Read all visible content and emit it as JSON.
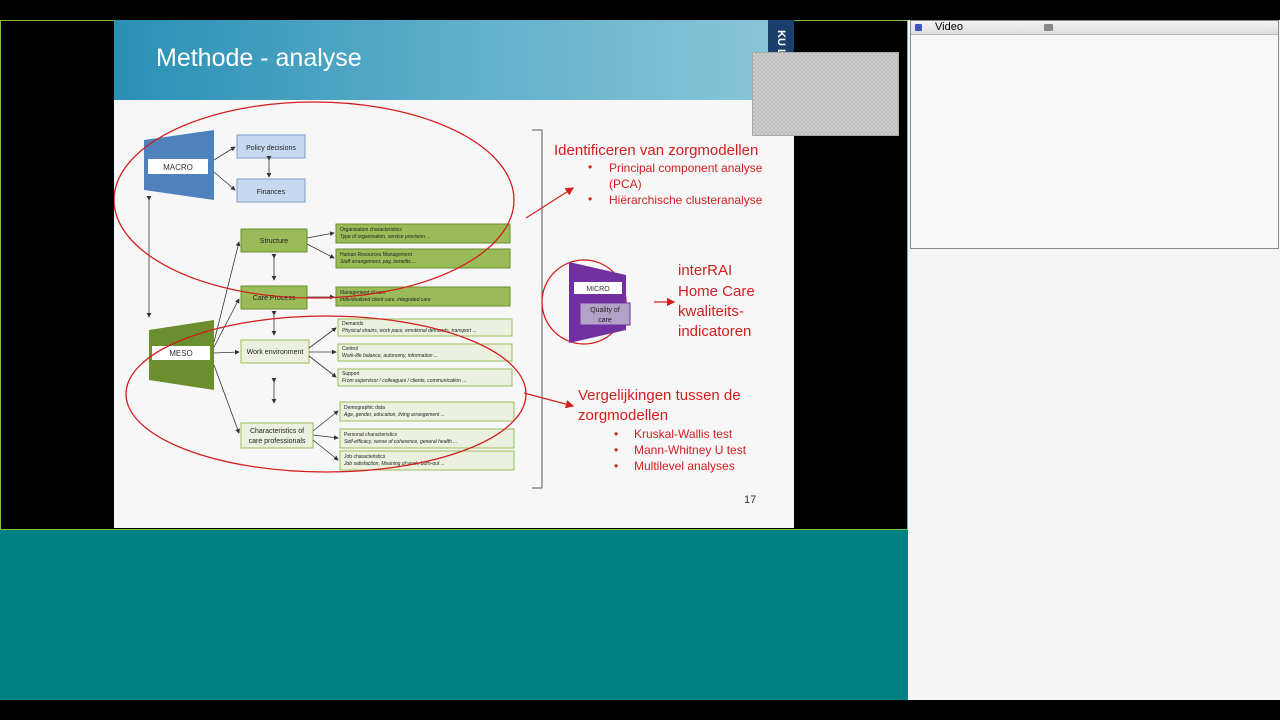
{
  "video_window": {
    "title": "Video"
  },
  "slide": {
    "title": "Methode - analyse",
    "page_number": "17",
    "logo_text": "KU L",
    "diagram": {
      "macro_label": "MACRO",
      "policy": "Policy decisions",
      "finances": "Finances",
      "meso_label": "MESO",
      "structure": "Structure",
      "care_process": "Care Process",
      "work_environment": "Work environment",
      "characteristics_line1": "Characteristics of",
      "characteristics_line2": "care professionals",
      "boxes": [
        {
          "title": "Organisation characteristics",
          "sub": "Type of organisation, service provision ..."
        },
        {
          "title": "Human Resources Management",
          "sub": "Staff arrangement, pay, benefits ..."
        },
        {
          "title": "Management of care",
          "sub": "Individualized client care, integrated care"
        },
        {
          "title": "Demands",
          "sub": "Physical strains, work pace, emotional demands, transport ..."
        },
        {
          "title": "Control",
          "sub": "Work-life balance, autonomy, information ..."
        },
        {
          "title": "Support",
          "sub": "From supervisor / colleagues / clients, communication ..."
        },
        {
          "title": "Demographic data",
          "sub": "Age, gender, education, living arrangement ..."
        },
        {
          "title": "Personal characteristics",
          "sub": "Self-efficacy, sense of coherence, general health ..."
        },
        {
          "title": "Job characteristics",
          "sub": "Job satisfaction, Meaning of work, burn-out ..."
        }
      ],
      "micro_label": "MICRO",
      "quality_line1": "Quality of",
      "quality_line2": "care"
    },
    "right_text": {
      "identify_heading": "Identificeren van zorgmodellen",
      "identify_bullets": [
        "Principal component analyse",
        "(PCA)",
        "Hiërarchische clusteranalyse"
      ],
      "interrai_lines": [
        "interRAI",
        "Home Care",
        "kwaliteits-",
        "indicatoren"
      ],
      "compare_heading_1": "Vergelijkingen tussen de",
      "compare_heading_2": "zorgmodellen",
      "compare_bullets": [
        "Kruskal-Wallis test",
        "Mann-Whitney U test",
        "Multilevel analyses"
      ]
    }
  },
  "colors": {
    "accent_red": "#d21e1e",
    "macro_blue": "#4f81bd",
    "meso_green": "#6b8e2e",
    "micro_purple": "#7030a0",
    "green_box": "#9bbb59",
    "teal": "#008080"
  }
}
